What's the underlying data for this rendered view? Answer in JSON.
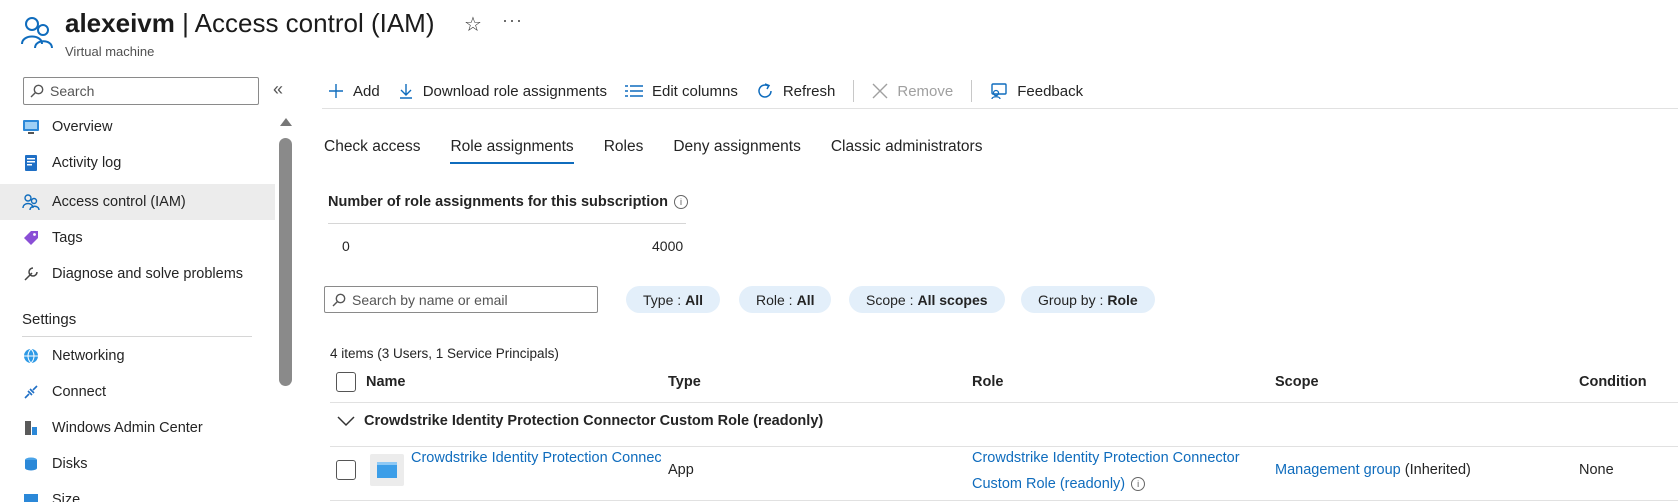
{
  "header": {
    "resource_name": "alexeivm",
    "separator": " | ",
    "page_name": "Access control (IAM)",
    "subtitle": "Virtual machine",
    "favorite_icon": "star-outline-icon",
    "more_label": "···"
  },
  "sidebar": {
    "search_placeholder": "Search",
    "collapse_label": "«",
    "items": [
      {
        "label": "Overview",
        "icon": "monitor-icon"
      },
      {
        "label": "Activity log",
        "icon": "log-icon"
      },
      {
        "label": "Access control (IAM)",
        "icon": "people-icon",
        "active": true
      },
      {
        "label": "Tags",
        "icon": "tag-icon"
      },
      {
        "label": "Diagnose and solve problems",
        "icon": "wrench-icon"
      }
    ],
    "settings_header": "Settings",
    "settings_items": [
      {
        "label": "Networking",
        "icon": "network-icon"
      },
      {
        "label": "Connect",
        "icon": "connect-icon"
      },
      {
        "label": "Windows Admin Center",
        "icon": "admin-center-icon"
      },
      {
        "label": "Disks",
        "icon": "disk-icon"
      },
      {
        "label": "Size",
        "icon": "size-icon"
      }
    ]
  },
  "toolbar": {
    "add": "Add",
    "download": "Download role assignments",
    "edit_columns": "Edit columns",
    "refresh": "Refresh",
    "remove": "Remove",
    "feedback": "Feedback"
  },
  "tabs": [
    "Check access",
    "Role assignments",
    "Roles",
    "Deny assignments",
    "Classic administrators"
  ],
  "subscription": {
    "title": "Number of role assignments for this subscription",
    "min": "0",
    "max": "4000"
  },
  "filters": {
    "search_placeholder": "Search by name or email",
    "type_label": "Type :",
    "type_value": "All",
    "role_label": "Role :",
    "role_value": "All",
    "scope_label": "Scope :",
    "scope_value": "All scopes",
    "group_label": "Group by :",
    "group_value": "Role"
  },
  "table": {
    "items_count": "4 items (3 Users, 1 Service Principals)",
    "columns": {
      "name": "Name",
      "type": "Type",
      "role": "Role",
      "scope": "Scope",
      "condition": "Condition"
    },
    "group_label": "Crowdstrike Identity Protection Connector Custom Role (readonly)",
    "rows": [
      {
        "name": "Crowdstrike Identity Protection Connec",
        "type": "App",
        "role_line1": "Crowdstrike Identity Protection Connector",
        "role_line2": "Custom Role (readonly)",
        "scope_link": "Management group",
        "scope_suffix": " (Inherited)",
        "condition": "None"
      }
    ]
  },
  "colors": {
    "accent": "#0f6cbd",
    "pill_bg": "#e3effa",
    "active_item_bg": "#ececec"
  }
}
